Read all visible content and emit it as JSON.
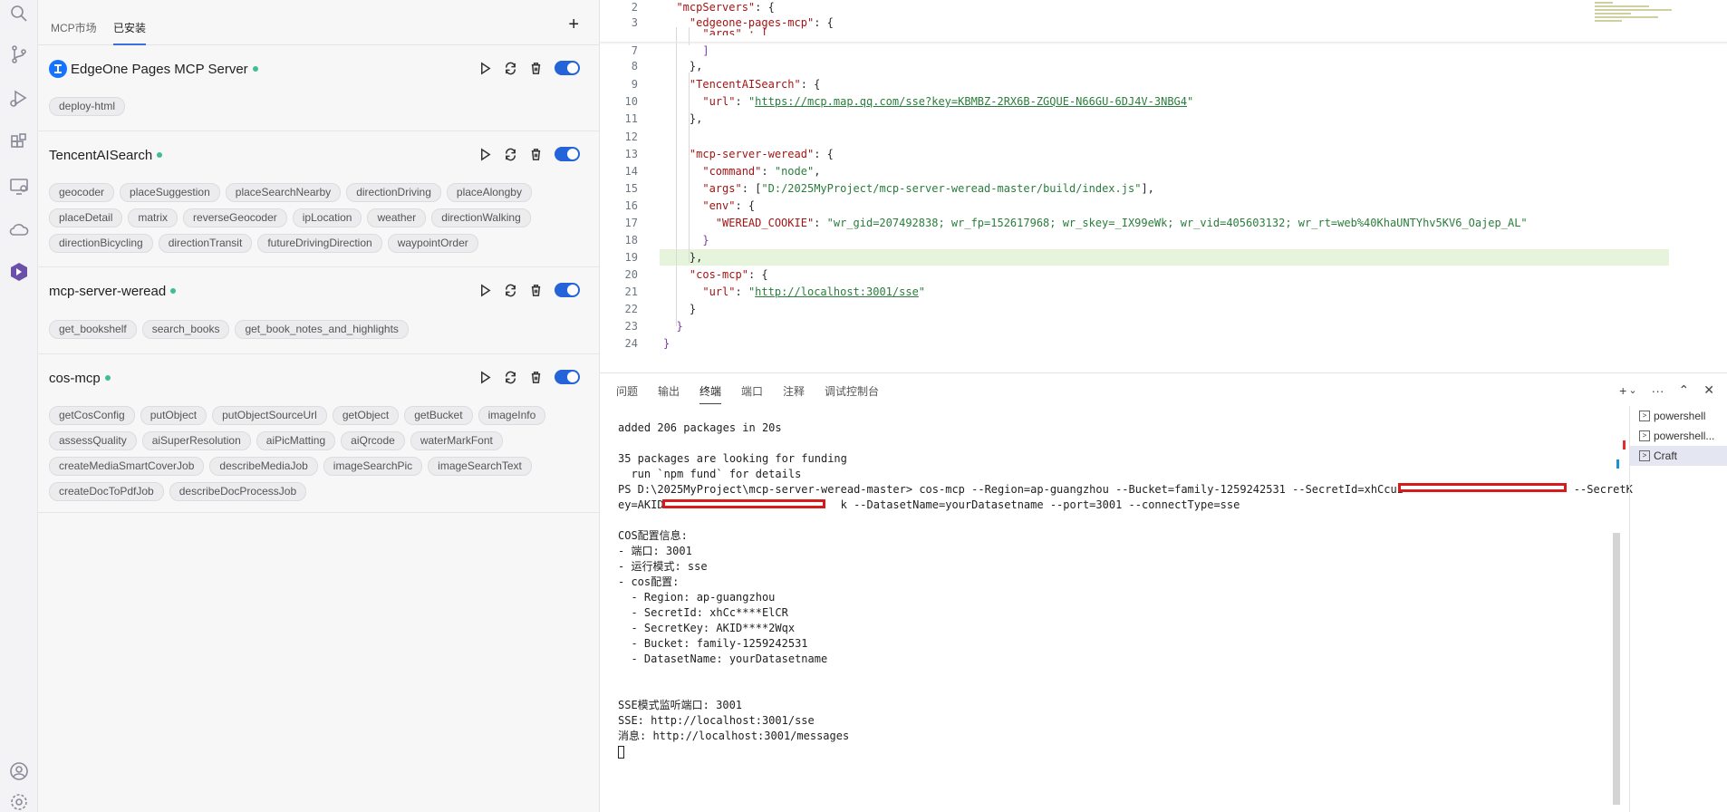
{
  "activity_bar": {
    "icons": [
      "search-icon",
      "source-control-icon",
      "run-debug-icon",
      "extensions-icon",
      "remote-explorer-icon",
      "cloud-icon",
      "craft-icon",
      "account-icon",
      "settings-icon"
    ]
  },
  "mcp_panel": {
    "tabs": [
      "MCP市场",
      "已安装"
    ],
    "add_label": "+",
    "servers": [
      {
        "name": "EdgeOne Pages MCP Server",
        "status": "running",
        "tools": [
          "deploy-html"
        ]
      },
      {
        "name": "TencentAISearch",
        "status": "running",
        "tools": [
          "geocoder",
          "placeSuggestion",
          "placeSearchNearby",
          "directionDriving",
          "placeAlongby",
          "placeDetail",
          "matrix",
          "reverseGeocoder",
          "ipLocation",
          "weather",
          "directionWalking",
          "directionBicycling",
          "directionTransit",
          "futureDrivingDirection",
          "waypointOrder"
        ]
      },
      {
        "name": "mcp-server-weread",
        "status": "running",
        "tools": [
          "get_bookshelf",
          "search_books",
          "get_book_notes_and_highlights"
        ]
      },
      {
        "name": "cos-mcp",
        "status": "running",
        "tools": [
          "getCosConfig",
          "putObject",
          "putObjectSourceUrl",
          "getObject",
          "getBucket",
          "imageInfo",
          "assessQuality",
          "aiSuperResolution",
          "aiPicMatting",
          "aiQrcode",
          "waterMarkFont",
          "createMediaSmartCoverJob",
          "describeMediaJob",
          "imageSearchPic",
          "imageSearchText",
          "createDocToPdfJob",
          "describeDocProcessJob"
        ]
      }
    ],
    "accent_color": "#2563d8",
    "status_color": "#3fbf8f"
  },
  "editor": {
    "line_numbers": [
      "2",
      "3",
      "7",
      "8",
      "9",
      "10",
      "11",
      "12",
      "13",
      "14",
      "15",
      "16",
      "17",
      "18",
      "19",
      "20",
      "21",
      "22",
      "23",
      "24"
    ],
    "lines": {
      "l2a": "\"mcpServers\"",
      "l2b": ": {",
      "l3a": "\"edgeone-pages-mcp\"",
      "l3b": ": {",
      "l3c": "\"args\" : [",
      "l7": "]",
      "l8": "},",
      "l9a": "\"TencentAISearch\"",
      "l9b": ": {",
      "l10a": "\"url\"",
      "l10b": ": ",
      "l10c": "\"",
      "l10d": "https://mcp.map.qq.com/sse?key=KBMBZ-2RX6B-ZGQUE-N66GU-6DJ4V-3NBG4",
      "l10e": "\"",
      "l11": "},",
      "l13a": "\"mcp-server-weread\"",
      "l13b": ": {",
      "l14a": "\"command\"",
      "l14b": ": ",
      "l14c": "\"node\"",
      "l14d": ",",
      "l15a": "\"args\"",
      "l15b": ": [",
      "l15c": "\"D:/2025MyProject/mcp-server-weread-master/build/index.js\"",
      "l15d": "],",
      "l16a": "\"env\"",
      "l16b": ": {",
      "l17a": "\"WEREAD_COOKIE\"",
      "l17b": ": ",
      "l17c": "\"wr_gid=207492838; wr_fp=152617968; wr_skey=_IX99eWk; wr_vid=405603132; wr_rt=web%40KhaUNTYhv5KV6_Oajep_AL\"",
      "l18": "}",
      "l19": "},",
      "l20a": "\"cos-mcp\"",
      "l20b": ": {",
      "l21a": "\"url\"",
      "l21b": ": ",
      "l21c": "\"",
      "l21d": "http://localhost:3001/sse",
      "l21e": "\"",
      "l22": "}",
      "l23": "}",
      "l24": "}"
    }
  },
  "panel": {
    "tabs": [
      "问题",
      "输出",
      "终端",
      "端口",
      "注释",
      "调试控制台"
    ],
    "active_tab": "终端",
    "tools": [
      "+",
      "⌄",
      "···",
      "⌃",
      "✕"
    ],
    "terminals": [
      "powershell",
      "powershell...",
      "Craft"
    ],
    "terminal_lines": [
      "added 206 packages in 20s",
      "",
      "35 packages are looking for funding",
      "  run `npm fund` for details",
      "PS D:\\2025MyProject\\mcp-server-weread-master> cos-mcp --Region=ap-guangzhou --Bucket=family-1259242531 --SecretId=xhCcuz                          --SecretK",
      "ey=AKID                           k --DatasetName=yourDatasetname --port=3001 --connectType=sse",
      "",
      "COS配置信息:",
      "- 端口: 3001",
      "- 运行模式: sse",
      "- cos配置:",
      "  - Region: ap-guangzhou",
      "  - SecretId: xhCc****ElCR",
      "  - SecretKey: AKID****2Wqx",
      "  - Bucket: family-1259242531",
      "  - DatasetName: yourDatasetname",
      "",
      "",
      "SSE模式监听端口: 3001",
      "SSE: http://localhost:3001/sse",
      "消息: http://localhost:3001/messages"
    ]
  }
}
